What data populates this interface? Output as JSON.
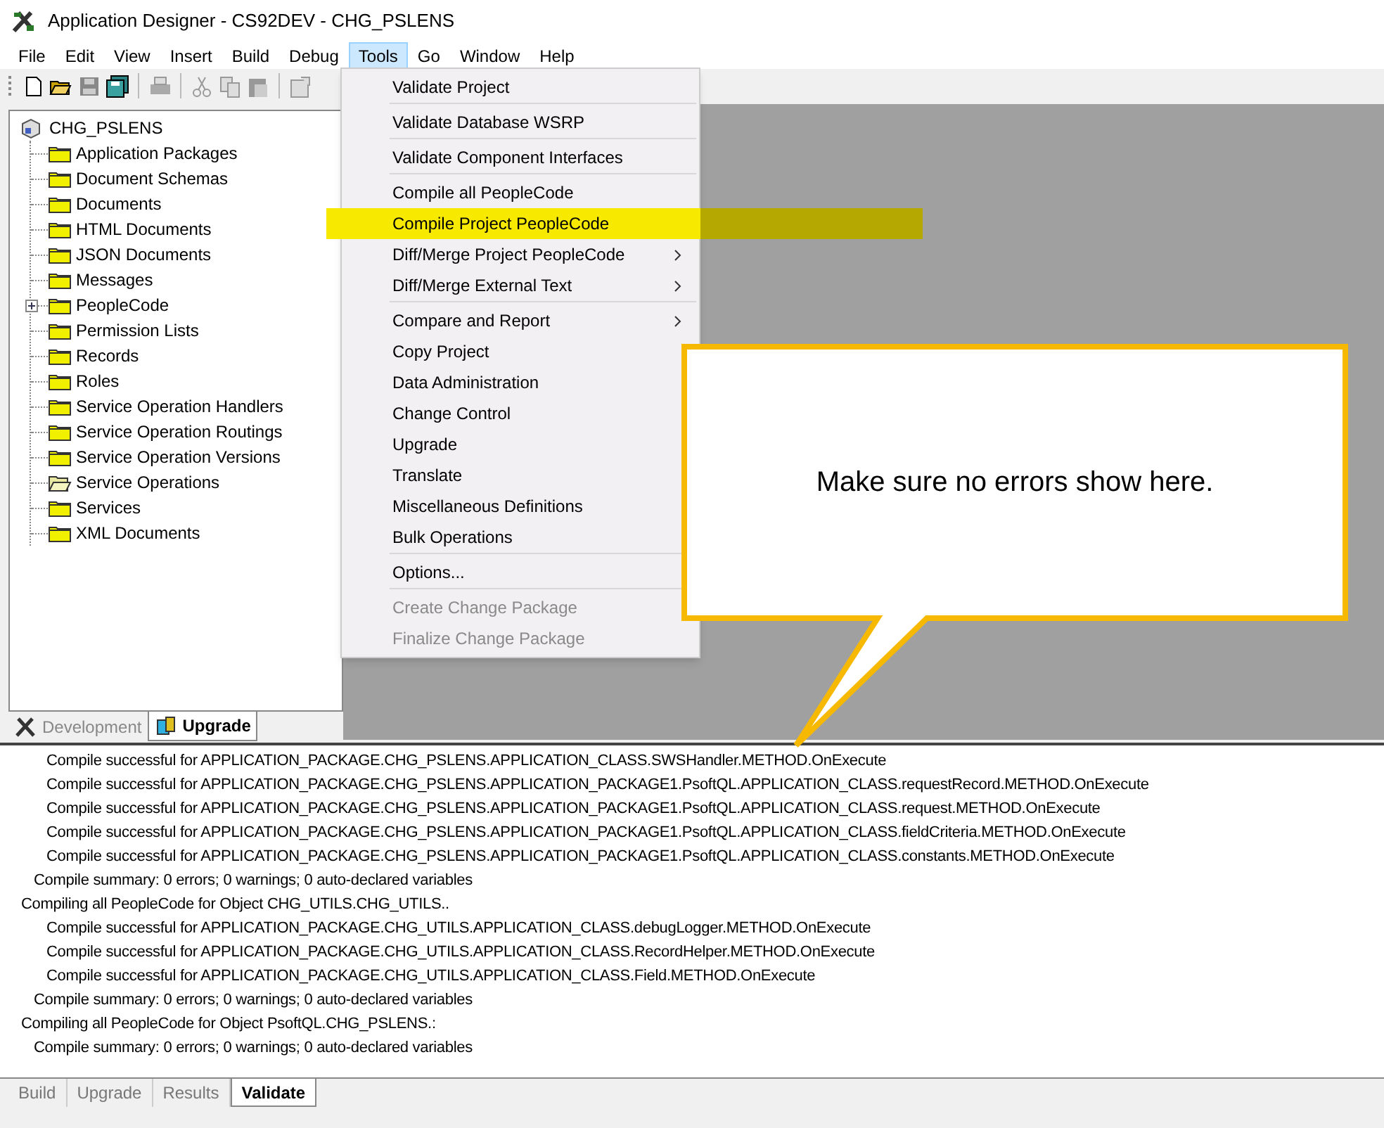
{
  "window": {
    "title": "Application Designer - CS92DEV - CHG_PSLENS"
  },
  "menu_bar": [
    {
      "label": "File",
      "selected": false
    },
    {
      "label": "Edit",
      "selected": false
    },
    {
      "label": "View",
      "selected": false
    },
    {
      "label": "Insert",
      "selected": false
    },
    {
      "label": "Build",
      "selected": false
    },
    {
      "label": "Debug",
      "selected": false
    },
    {
      "label": "Tools",
      "selected": true
    },
    {
      "label": "Go",
      "selected": false
    },
    {
      "label": "Window",
      "selected": false
    },
    {
      "label": "Help",
      "selected": false
    }
  ],
  "project_tree": {
    "root": "CHG_PSLENS",
    "children": [
      {
        "label": "Application Packages",
        "kind": "folder",
        "expandable": false
      },
      {
        "label": "Document Schemas",
        "kind": "folder",
        "expandable": false
      },
      {
        "label": "Documents",
        "kind": "folder",
        "expandable": false
      },
      {
        "label": "HTML Documents",
        "kind": "folder",
        "expandable": false
      },
      {
        "label": "JSON Documents",
        "kind": "folder",
        "expandable": false
      },
      {
        "label": "Messages",
        "kind": "folder",
        "expandable": false
      },
      {
        "label": "PeopleCode",
        "kind": "folder",
        "expandable": true
      },
      {
        "label": "Permission Lists",
        "kind": "folder",
        "expandable": false
      },
      {
        "label": "Records",
        "kind": "folder",
        "expandable": false
      },
      {
        "label": "Roles",
        "kind": "folder",
        "expandable": false
      },
      {
        "label": "Service Operation Handlers",
        "kind": "folder",
        "expandable": false
      },
      {
        "label": "Service Operation Routings",
        "kind": "folder",
        "expandable": false
      },
      {
        "label": "Service Operation Versions",
        "kind": "folder",
        "expandable": false
      },
      {
        "label": "Service Operations",
        "kind": "open-folder",
        "expandable": false
      },
      {
        "label": "Services",
        "kind": "folder",
        "expandable": false
      },
      {
        "label": "XML Documents",
        "kind": "folder",
        "expandable": false
      }
    ]
  },
  "project_tabs": [
    {
      "label": "Development",
      "selected": false
    },
    {
      "label": "Upgrade",
      "selected": true
    }
  ],
  "tools_menu": [
    [
      {
        "label": "Validate Project",
        "submenu": false,
        "disabled": false,
        "selected": false
      }
    ],
    [
      {
        "label": "Validate Database WSRP",
        "submenu": false,
        "disabled": false,
        "selected": false
      }
    ],
    [
      {
        "label": "Validate Component Interfaces",
        "submenu": false,
        "disabled": false,
        "selected": false
      }
    ],
    [
      {
        "label": "Compile all PeopleCode",
        "submenu": false,
        "disabled": false,
        "selected": false
      },
      {
        "label": "Compile Project PeopleCode",
        "submenu": false,
        "disabled": false,
        "selected": true
      },
      {
        "label": "Diff/Merge Project PeopleCode",
        "submenu": true,
        "disabled": false,
        "selected": false
      },
      {
        "label": "Diff/Merge External Text",
        "submenu": true,
        "disabled": false,
        "selected": false
      }
    ],
    [
      {
        "label": "Compare and Report",
        "submenu": true,
        "disabled": false,
        "selected": false
      },
      {
        "label": "Copy Project",
        "submenu": false,
        "disabled": false,
        "selected": false
      },
      {
        "label": "Data Administration",
        "submenu": false,
        "disabled": false,
        "selected": false
      },
      {
        "label": "Change Control",
        "submenu": false,
        "disabled": false,
        "selected": false
      },
      {
        "label": "Upgrade",
        "submenu": false,
        "disabled": false,
        "selected": false
      },
      {
        "label": "Translate",
        "submenu": false,
        "disabled": false,
        "selected": false
      },
      {
        "label": "Miscellaneous Definitions",
        "submenu": false,
        "disabled": false,
        "selected": false
      },
      {
        "label": "Bulk Operations",
        "submenu": false,
        "disabled": false,
        "selected": false
      }
    ],
    [
      {
        "label": "Options...",
        "submenu": false,
        "disabled": false,
        "selected": false
      }
    ],
    [
      {
        "label": "Create Change Package",
        "submenu": false,
        "disabled": true,
        "selected": false
      },
      {
        "label": "Finalize Change Package",
        "submenu": false,
        "disabled": true,
        "selected": false
      }
    ]
  ],
  "callout": {
    "text": "Make sure no errors show here."
  },
  "output": [
    {
      "kind": "result",
      "text": "Compile successful for APPLICATION_PACKAGE.CHG_PSLENS.APPLICATION_CLASS.SWSHandler.METHOD.OnExecute"
    },
    {
      "kind": "result",
      "text": "Compile successful for APPLICATION_PACKAGE.CHG_PSLENS.APPLICATION_PACKAGE1.PsoftQL.APPLICATION_CLASS.requestRecord.METHOD.OnExecute"
    },
    {
      "kind": "result",
      "text": "Compile successful for APPLICATION_PACKAGE.CHG_PSLENS.APPLICATION_PACKAGE1.PsoftQL.APPLICATION_CLASS.request.METHOD.OnExecute"
    },
    {
      "kind": "result",
      "text": "Compile successful for APPLICATION_PACKAGE.CHG_PSLENS.APPLICATION_PACKAGE1.PsoftQL.APPLICATION_CLASS.fieldCriteria.METHOD.OnExecute"
    },
    {
      "kind": "result",
      "text": "Compile successful for APPLICATION_PACKAGE.CHG_PSLENS.APPLICATION_PACKAGE1.PsoftQL.APPLICATION_CLASS.constants.METHOD.OnExecute"
    },
    {
      "kind": "summary",
      "text": "Compile summary: 0 errors; 0 warnings; 0 auto-declared variables"
    },
    {
      "kind": "object",
      "text": "Compiling all PeopleCode for Object CHG_UTILS.CHG_UTILS.."
    },
    {
      "kind": "result",
      "text": "Compile successful for APPLICATION_PACKAGE.CHG_UTILS.APPLICATION_CLASS.debugLogger.METHOD.OnExecute"
    },
    {
      "kind": "result",
      "text": "Compile successful for APPLICATION_PACKAGE.CHG_UTILS.APPLICATION_CLASS.RecordHelper.METHOD.OnExecute"
    },
    {
      "kind": "result",
      "text": "Compile successful for APPLICATION_PACKAGE.CHG_UTILS.APPLICATION_CLASS.Field.METHOD.OnExecute"
    },
    {
      "kind": "summary",
      "text": "Compile summary: 0 errors; 0 warnings; 0 auto-declared variables"
    },
    {
      "kind": "object",
      "text": "Compiling all PeopleCode for Object PsoftQL.CHG_PSLENS.:"
    },
    {
      "kind": "summary",
      "text": "Compile summary: 0 errors; 0 warnings; 0 auto-declared variables"
    }
  ],
  "output_tabs": [
    {
      "label": "Build",
      "selected": false
    },
    {
      "label": "Upgrade",
      "selected": false
    },
    {
      "label": "Results",
      "selected": false
    },
    {
      "label": "Validate",
      "selected": true
    }
  ]
}
